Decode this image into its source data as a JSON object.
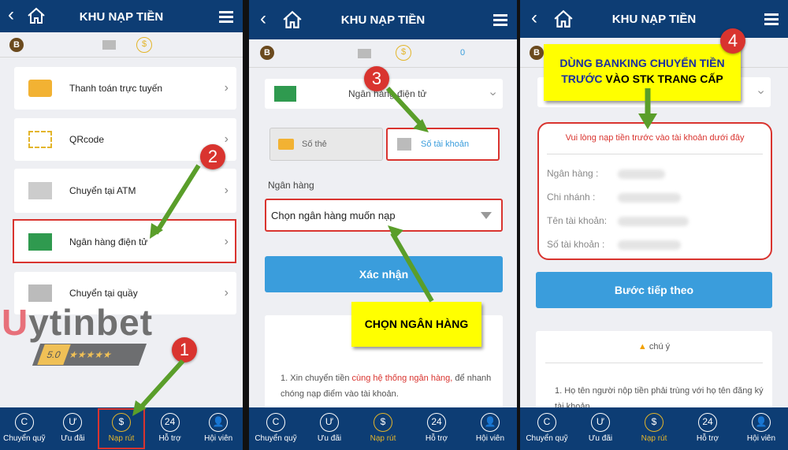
{
  "header": {
    "title": "KHU NẠP TIỀN"
  },
  "sub": {
    "badge": "B",
    "coin": "$",
    "balance": "0"
  },
  "panel1": {
    "items": [
      {
        "label": "Thanh toán trực tuyến",
        "icon": "card-payment-icon"
      },
      {
        "label": "QRcode",
        "icon": "qr-scan-icon"
      },
      {
        "label": "Chuyển tại ATM",
        "icon": "atm-icon"
      },
      {
        "label": "Ngân hàng điện tử",
        "icon": "laptop-icon"
      },
      {
        "label": "Chuyển tại quầy",
        "icon": "bank-icon"
      }
    ],
    "watermark": {
      "brand": "Uytinbet",
      "rating": "5.0",
      "stars": "★★★★★"
    }
  },
  "panel2": {
    "method": "Ngân hàng điện tử",
    "tabs": [
      "Số thẻ",
      "Số tài khoản"
    ],
    "bank_label": "Ngân hàng",
    "bank_select": "Chọn ngân hàng muốn nạp",
    "confirm": "Xác nhận",
    "callout": "CHỌN NGÂN HÀNG",
    "note_prefix": "1. Xin chuyển tiền ",
    "note_red": "cùng hệ thống ngân hàng,",
    "note_suffix": " để nhanh chóng nạp điểm vào tài khoản."
  },
  "panel3": {
    "callout_line1": "DÙNG BANKING CHUYỂN TIỀN",
    "callout_line2a": "TRƯỚC",
    "callout_line2b": " VÀO STK TRANG CẤP",
    "info_title": "Vui lòng nạp tiền trước vào tài khoản dưới đây",
    "fields": [
      "Ngân hàng :",
      "Chi nhánh :",
      "Tên tài khoản:",
      "Số tài khoản :"
    ],
    "next": "Bước tiếp theo",
    "notice": "chú ý",
    "note": "1. Họ tên người nộp tiền phải trùng với họ tên đăng ký tài khoản"
  },
  "steps": [
    "1",
    "2",
    "3",
    "4"
  ],
  "nav": [
    {
      "label": "Chuyển quỹ",
      "glyph": "C"
    },
    {
      "label": "Ưu đãi",
      "glyph": "Ư"
    },
    {
      "label": "Nạp rút",
      "glyph": "$"
    },
    {
      "label": "Hỗ trợ",
      "glyph": "24"
    },
    {
      "label": "Hội viên",
      "glyph": "👤"
    }
  ],
  "colors": {
    "header": "#0d3d74",
    "accent": "#e3b52a",
    "highlight": "#d9342f",
    "button": "#3a9ddc",
    "callout": "#ffff00"
  }
}
